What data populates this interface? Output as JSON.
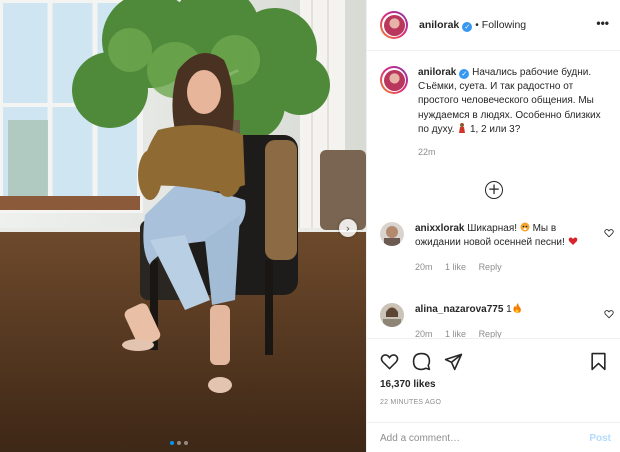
{
  "post": {
    "username": "anilorak",
    "follow_state": "Following",
    "separator": "•",
    "more": "•••",
    "caption": {
      "username": "anilorak",
      "text_1": "Начались рабочие будни. Съёмки, суета. И так радостно от простого человеческого общения. Мы нуждаемся в людях. Особенно близких по духу.",
      "text_2": "1, 2 или 3?",
      "time": "22m"
    },
    "load_more": "+",
    "comments": [
      {
        "username": "anixxlorak",
        "text_1": "Шикарная!",
        "text_2": "Мы в ожидании новой осенней песни!",
        "time": "20m",
        "likes": "1 like",
        "reply": "Reply"
      },
      {
        "username": "alina_nazarova775",
        "text_1": "1",
        "time": "20m",
        "likes": "1 like",
        "reply": "Reply"
      }
    ],
    "likes": "16,370 likes",
    "posted": "22 MINUTES AGO",
    "add_comment_placeholder": "Add a comment…",
    "post_button": "Post"
  },
  "carousel": {
    "slide_count": 3,
    "current_slide": 1,
    "next": "›"
  },
  "colors": {
    "verified": "#3897f0",
    "link_blue": "#0095f6",
    "muted": "#8e8e8e",
    "post_disabled": "#b3dbff"
  },
  "icons": [
    "verified-icon",
    "heart-icon",
    "comment-icon",
    "share-icon",
    "bookmark-icon",
    "add-circle-icon",
    "chevron-right-icon"
  ]
}
